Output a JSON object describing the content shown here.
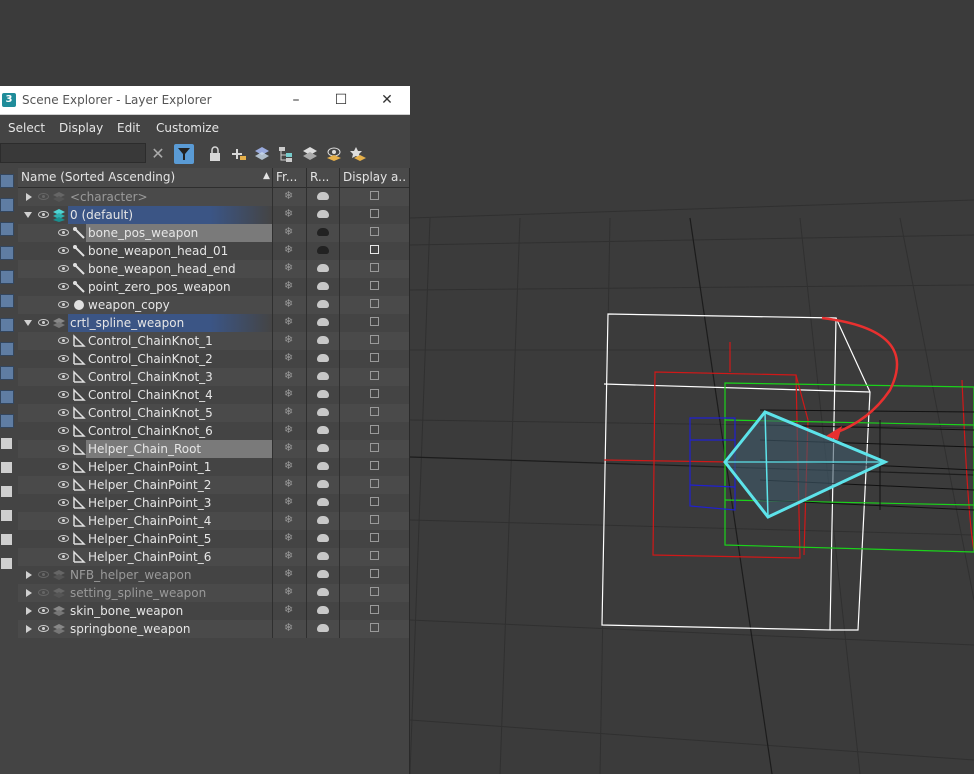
{
  "window": {
    "app_icon": "3",
    "title": "Scene Explorer - Layer Explorer",
    "controls": [
      "minimize-icon",
      "maximize-icon",
      "close-icon"
    ]
  },
  "menu": [
    "Select",
    "Display",
    "Edit",
    "Customize"
  ],
  "search": {
    "value": "",
    "placeholder": ""
  },
  "toolbar_icons": [
    "clear-icon",
    "filter-icon",
    "lock-icon",
    "add-to-layer-icon",
    "layers-icon",
    "hierarchy-icon",
    "layer-stack-icon",
    "layer-eye-icon",
    "layer-star-icon"
  ],
  "columns": {
    "name": "Name (Sorted Ascending)",
    "frozen": "Fr...",
    "render": "R...",
    "display": "Display a..."
  },
  "colors": {
    "selection": "#7a7a7a",
    "active_layer": "#3b5585",
    "viewport_bg": "#3b3b3b",
    "helper_cyan": "#5de3ea",
    "arc_red": "#e8302f"
  },
  "rows": [
    {
      "name": "<character>",
      "level": 0,
      "expander": "right",
      "type": "layer",
      "eye": false,
      "dim": true
    },
    {
      "name": "0 (default)",
      "level": 0,
      "expander": "down",
      "type": "layer-active",
      "eye": true,
      "highlight": "layer"
    },
    {
      "name": "bone_pos_weapon",
      "level": 1,
      "type": "bone",
      "eye": true,
      "highlight": "sel",
      "teapot": "dark"
    },
    {
      "name": "bone_weapon_head_01",
      "level": 1,
      "type": "bone",
      "eye": true,
      "teapot": "dark",
      "cube": "white"
    },
    {
      "name": "bone_weapon_head_end",
      "level": 1,
      "type": "bone",
      "eye": true
    },
    {
      "name": "point_zero_pos_weapon",
      "level": 1,
      "type": "bone",
      "eye": true
    },
    {
      "name": "weapon_copy",
      "level": 1,
      "type": "sphere",
      "eye": true
    },
    {
      "name": "crtl_spline_weapon",
      "level": 0,
      "expander": "down",
      "type": "layer",
      "eye": true,
      "highlight": "layer"
    },
    {
      "name": "Control_ChainKnot_1",
      "level": 1,
      "type": "shape",
      "eye": true
    },
    {
      "name": "Control_ChainKnot_2",
      "level": 1,
      "type": "shape",
      "eye": true
    },
    {
      "name": "Control_ChainKnot_3",
      "level": 1,
      "type": "shape",
      "eye": true
    },
    {
      "name": "Control_ChainKnot_4",
      "level": 1,
      "type": "shape",
      "eye": true
    },
    {
      "name": "Control_ChainKnot_5",
      "level": 1,
      "type": "shape",
      "eye": true
    },
    {
      "name": "Control_ChainKnot_6",
      "level": 1,
      "type": "shape",
      "eye": true
    },
    {
      "name": "Helper_Chain_Root",
      "level": 1,
      "type": "shape",
      "eye": true,
      "highlight": "sel"
    },
    {
      "name": "Helper_ChainPoint_1",
      "level": 1,
      "type": "shape",
      "eye": true
    },
    {
      "name": "Helper_ChainPoint_2",
      "level": 1,
      "type": "shape",
      "eye": true
    },
    {
      "name": "Helper_ChainPoint_3",
      "level": 1,
      "type": "shape",
      "eye": true
    },
    {
      "name": "Helper_ChainPoint_4",
      "level": 1,
      "type": "shape",
      "eye": true
    },
    {
      "name": "Helper_ChainPoint_5",
      "level": 1,
      "type": "shape",
      "eye": true
    },
    {
      "name": "Helper_ChainPoint_6",
      "level": 1,
      "type": "shape",
      "eye": true
    },
    {
      "name": "NFB_helper_weapon",
      "level": 0,
      "expander": "right",
      "type": "layer",
      "eye": false,
      "dim": true
    },
    {
      "name": "setting_spline_weapon",
      "level": 0,
      "expander": "right",
      "type": "layer",
      "eye": false,
      "dim": true
    },
    {
      "name": "skin_bone_weapon",
      "level": 0,
      "expander": "right",
      "type": "layer",
      "eye": true
    },
    {
      "name": "springbone_weapon",
      "level": 0,
      "expander": "right",
      "type": "layer",
      "eye": true
    }
  ],
  "side_icons": [
    "geometry-icon",
    "shapes-icon",
    "lights-icon",
    "cameras-icon",
    "helpers-icon",
    "spacewarps-icon",
    "groups-icon",
    "xrefs-icon",
    "bones-icon",
    "particles-icon",
    "visibility-icon",
    "select-all-icon",
    "select-none-icon",
    "invert-icon",
    "filter-icon",
    "funnel-icon",
    "folder-icon"
  ]
}
